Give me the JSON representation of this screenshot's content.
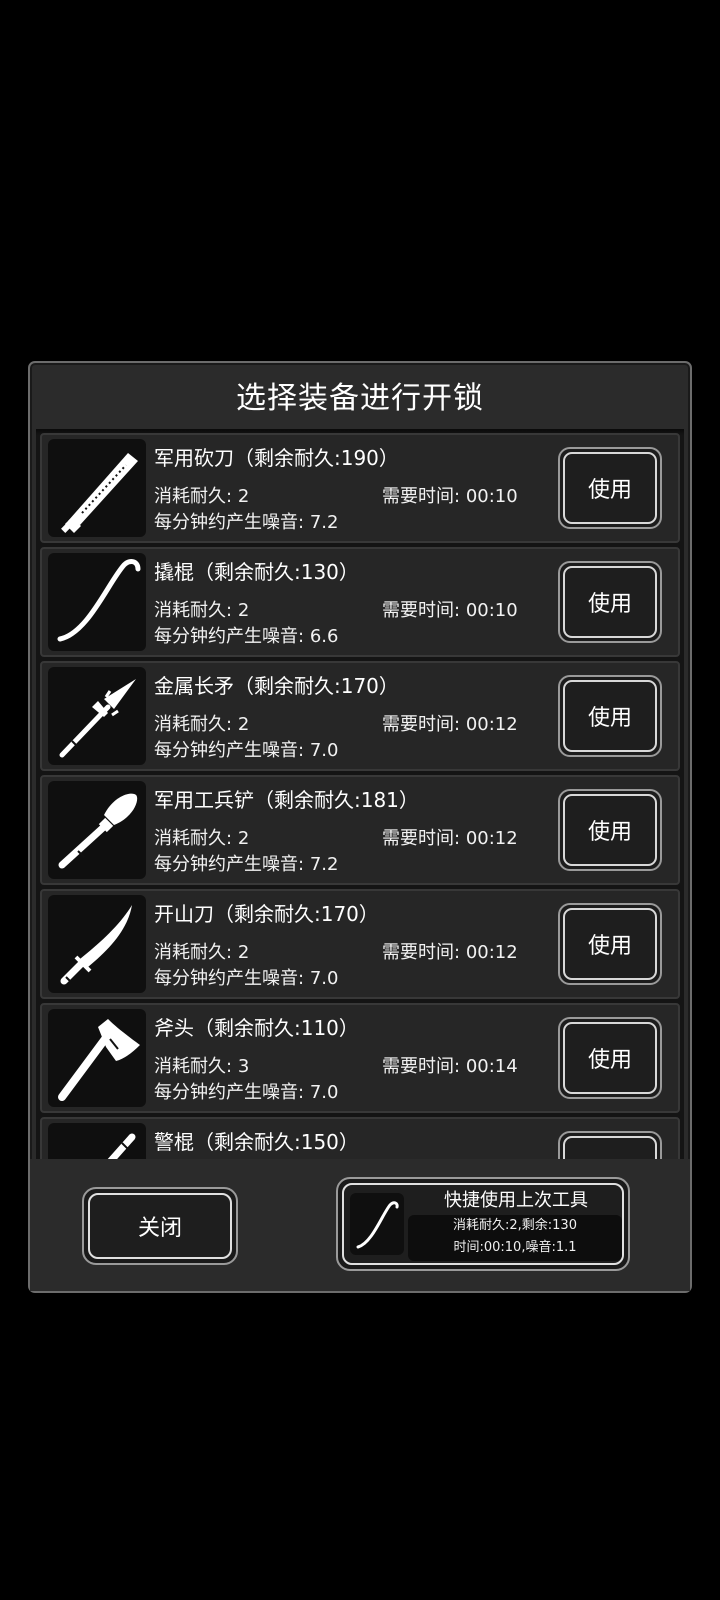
{
  "dialog": {
    "title": "选择装备进行开锁"
  },
  "labels": {
    "durability_cost": "消耗耐久:",
    "time_needed": "需要时间:",
    "noise_per_min": "每分钟约产生噪音:",
    "use": "使用"
  },
  "items": [
    {
      "name": "军用砍刀（剩余耐久:190）",
      "durability_cost": "2",
      "time": "00:10",
      "noise": "7.2",
      "icon": "machete-icon"
    },
    {
      "name": "撬棍（剩余耐久:130）",
      "durability_cost": "2",
      "time": "00:10",
      "noise": "6.6",
      "icon": "crowbar-icon"
    },
    {
      "name": "金属长矛（剩余耐久:170）",
      "durability_cost": "2",
      "time": "00:12",
      "noise": "7.0",
      "icon": "spear-icon"
    },
    {
      "name": "军用工兵铲（剩余耐久:181）",
      "durability_cost": "2",
      "time": "00:12",
      "noise": "7.2",
      "icon": "shovel-icon"
    },
    {
      "name": "开山刀（剩余耐久:170）",
      "durability_cost": "2",
      "time": "00:12",
      "noise": "7.0",
      "icon": "sword-icon"
    },
    {
      "name": "斧头（剩余耐久:110）",
      "durability_cost": "3",
      "time": "00:14",
      "noise": "7.0",
      "icon": "axe-icon"
    },
    {
      "name": "警棍（剩余耐久:150）",
      "icon": "baton-icon"
    }
  ],
  "footer": {
    "close_label": "关闭",
    "quick_use": {
      "title": "快捷使用上次工具",
      "line1": "消耗耐久:2,剩余:130",
      "line2": "时间:00:10,噪音:1.1",
      "icon": "crowbar-icon"
    }
  },
  "colors": {
    "panel": "#2b2b2b",
    "list_bg": "#141414",
    "item_bg": "#262626",
    "icon_fill": "#ffffff"
  }
}
